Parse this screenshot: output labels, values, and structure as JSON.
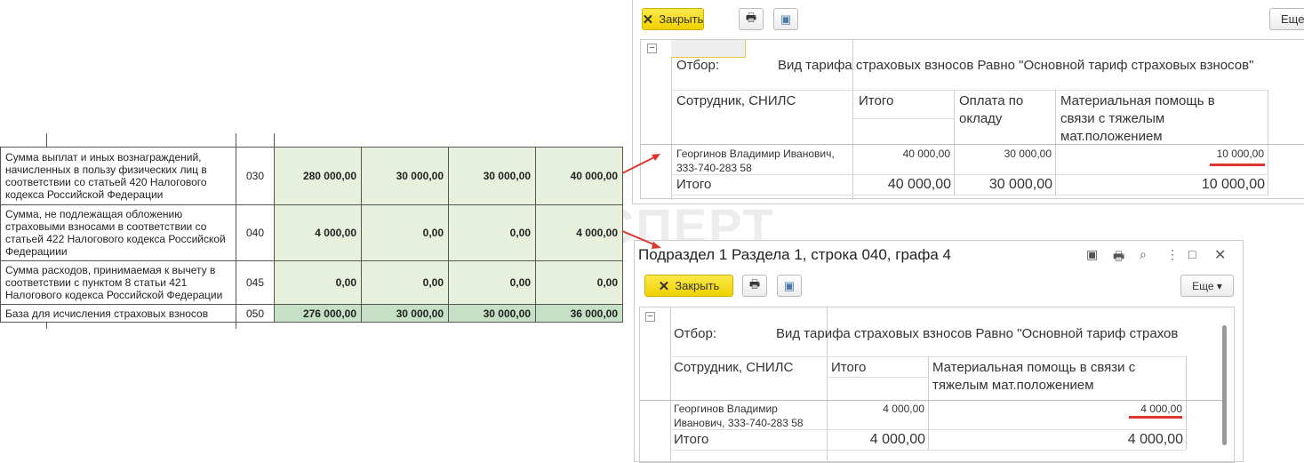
{
  "watermark": "БУХЭКСПЕРТ",
  "report_table": {
    "rows": [
      {
        "label": "Сумма выплат и иных вознаграждений, начисленных в пользу физических лиц в соответствии со статьей 420 Налогового кодекса Российской Федерации",
        "code": "030",
        "values": [
          "280 000,00",
          "30 000,00",
          "30 000,00",
          "40 000,00"
        ]
      },
      {
        "label": "Сумма, не подлежащая обложению страховыми взносами в соответствии со статьей 422 Налогового кодекса Российской  Федерациии",
        "code": "040",
        "values": [
          "4 000,00",
          "0,00",
          "0,00",
          "4 000,00"
        ]
      },
      {
        "label": "Сумма расходов, принимаемая к вычету в соответствии с пунктом 8 статьи 421 Налогового кодекса Российской Федерации",
        "code": "045",
        "values": [
          "0,00",
          "0,00",
          "0,00",
          "0,00"
        ]
      },
      {
        "label": "База для исчисления страховых взносов",
        "code": "050",
        "values": [
          "276 000,00",
          "30 000,00",
          "30 000,00",
          "36 000,00"
        ]
      }
    ]
  },
  "top_window": {
    "close_label": "Закрыть",
    "more_label": "Еще",
    "filter_label": "Отбор:",
    "filter_value": "Вид тарифа страховых взносов Равно \"Основной тариф страховых взносов\"",
    "headers": [
      "Сотрудник, СНИЛС",
      "Итого",
      "Оплата по окладу",
      "Материальная помощь в связи с тяжелым мат.положением"
    ],
    "row": [
      "Георгинов Владимир Иванович, 333-740-283 58",
      "40 000,00",
      "30 000,00",
      "10 000,00"
    ],
    "total": [
      "Итого",
      "40 000,00",
      "30 000,00",
      "10 000,00"
    ]
  },
  "bottom_window": {
    "title": "Подраздел 1 Раздела 1, строка 040, графа 4",
    "close_label": "Закрыть",
    "more_label": "Еще ▾",
    "filter_label": "Отбор:",
    "filter_value": "Вид тарифа страховых взносов Равно \"Основной тариф страхов",
    "headers": [
      "Сотрудник, СНИЛС",
      "Итого",
      "Материальная помощь в связи с тяжелым мат.положением"
    ],
    "row": [
      "Георгинов Владимир Иванович, 333-740-283 58",
      "4 000,00",
      "4 000,00"
    ],
    "total": [
      "Итого",
      "4 000,00",
      "4 000,00"
    ]
  },
  "colors": {
    "highlight": "#e0352b",
    "button": "#f0d200",
    "cell_green": "#e6f0dc"
  }
}
